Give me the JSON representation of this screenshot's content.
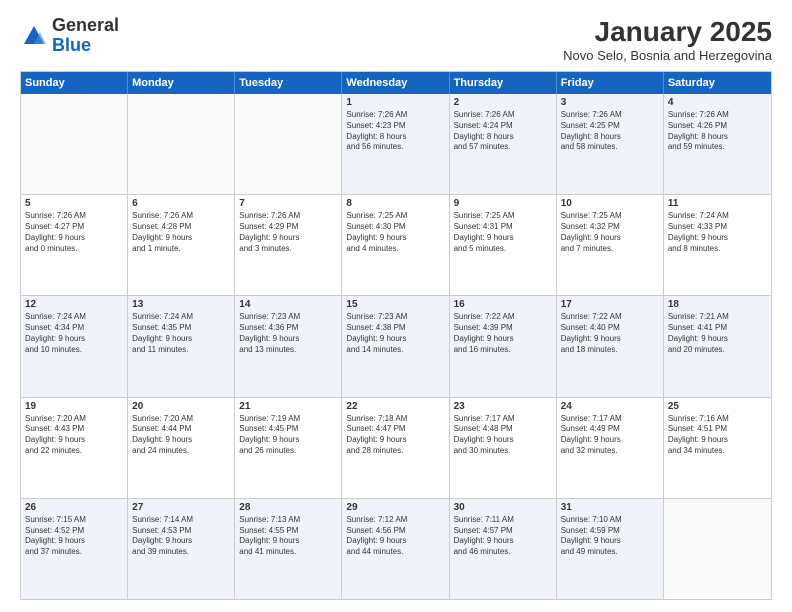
{
  "logo": {
    "general": "General",
    "blue": "Blue"
  },
  "title": {
    "month_year": "January 2025",
    "location": "Novo Selo, Bosnia and Herzegovina"
  },
  "weekdays": [
    "Sunday",
    "Monday",
    "Tuesday",
    "Wednesday",
    "Thursday",
    "Friday",
    "Saturday"
  ],
  "rows": [
    [
      {
        "day": "",
        "lines": []
      },
      {
        "day": "",
        "lines": []
      },
      {
        "day": "",
        "lines": []
      },
      {
        "day": "1",
        "lines": [
          "Sunrise: 7:26 AM",
          "Sunset: 4:23 PM",
          "Daylight: 8 hours",
          "and 56 minutes."
        ]
      },
      {
        "day": "2",
        "lines": [
          "Sunrise: 7:26 AM",
          "Sunset: 4:24 PM",
          "Daylight: 8 hours",
          "and 57 minutes."
        ]
      },
      {
        "day": "3",
        "lines": [
          "Sunrise: 7:26 AM",
          "Sunset: 4:25 PM",
          "Daylight: 8 hours",
          "and 58 minutes."
        ]
      },
      {
        "day": "4",
        "lines": [
          "Sunrise: 7:26 AM",
          "Sunset: 4:26 PM",
          "Daylight: 8 hours",
          "and 59 minutes."
        ]
      }
    ],
    [
      {
        "day": "5",
        "lines": [
          "Sunrise: 7:26 AM",
          "Sunset: 4:27 PM",
          "Daylight: 9 hours",
          "and 0 minutes."
        ]
      },
      {
        "day": "6",
        "lines": [
          "Sunrise: 7:26 AM",
          "Sunset: 4:28 PM",
          "Daylight: 9 hours",
          "and 1 minute."
        ]
      },
      {
        "day": "7",
        "lines": [
          "Sunrise: 7:26 AM",
          "Sunset: 4:29 PM",
          "Daylight: 9 hours",
          "and 3 minutes."
        ]
      },
      {
        "day": "8",
        "lines": [
          "Sunrise: 7:25 AM",
          "Sunset: 4:30 PM",
          "Daylight: 9 hours",
          "and 4 minutes."
        ]
      },
      {
        "day": "9",
        "lines": [
          "Sunrise: 7:25 AM",
          "Sunset: 4:31 PM",
          "Daylight: 9 hours",
          "and 5 minutes."
        ]
      },
      {
        "day": "10",
        "lines": [
          "Sunrise: 7:25 AM",
          "Sunset: 4:32 PM",
          "Daylight: 9 hours",
          "and 7 minutes."
        ]
      },
      {
        "day": "11",
        "lines": [
          "Sunrise: 7:24 AM",
          "Sunset: 4:33 PM",
          "Daylight: 9 hours",
          "and 8 minutes."
        ]
      }
    ],
    [
      {
        "day": "12",
        "lines": [
          "Sunrise: 7:24 AM",
          "Sunset: 4:34 PM",
          "Daylight: 9 hours",
          "and 10 minutes."
        ]
      },
      {
        "day": "13",
        "lines": [
          "Sunrise: 7:24 AM",
          "Sunset: 4:35 PM",
          "Daylight: 9 hours",
          "and 11 minutes."
        ]
      },
      {
        "day": "14",
        "lines": [
          "Sunrise: 7:23 AM",
          "Sunset: 4:36 PM",
          "Daylight: 9 hours",
          "and 13 minutes."
        ]
      },
      {
        "day": "15",
        "lines": [
          "Sunrise: 7:23 AM",
          "Sunset: 4:38 PM",
          "Daylight: 9 hours",
          "and 14 minutes."
        ]
      },
      {
        "day": "16",
        "lines": [
          "Sunrise: 7:22 AM",
          "Sunset: 4:39 PM",
          "Daylight: 9 hours",
          "and 16 minutes."
        ]
      },
      {
        "day": "17",
        "lines": [
          "Sunrise: 7:22 AM",
          "Sunset: 4:40 PM",
          "Daylight: 9 hours",
          "and 18 minutes."
        ]
      },
      {
        "day": "18",
        "lines": [
          "Sunrise: 7:21 AM",
          "Sunset: 4:41 PM",
          "Daylight: 9 hours",
          "and 20 minutes."
        ]
      }
    ],
    [
      {
        "day": "19",
        "lines": [
          "Sunrise: 7:20 AM",
          "Sunset: 4:43 PM",
          "Daylight: 9 hours",
          "and 22 minutes."
        ]
      },
      {
        "day": "20",
        "lines": [
          "Sunrise: 7:20 AM",
          "Sunset: 4:44 PM",
          "Daylight: 9 hours",
          "and 24 minutes."
        ]
      },
      {
        "day": "21",
        "lines": [
          "Sunrise: 7:19 AM",
          "Sunset: 4:45 PM",
          "Daylight: 9 hours",
          "and 26 minutes."
        ]
      },
      {
        "day": "22",
        "lines": [
          "Sunrise: 7:18 AM",
          "Sunset: 4:47 PM",
          "Daylight: 9 hours",
          "and 28 minutes."
        ]
      },
      {
        "day": "23",
        "lines": [
          "Sunrise: 7:17 AM",
          "Sunset: 4:48 PM",
          "Daylight: 9 hours",
          "and 30 minutes."
        ]
      },
      {
        "day": "24",
        "lines": [
          "Sunrise: 7:17 AM",
          "Sunset: 4:49 PM",
          "Daylight: 9 hours",
          "and 32 minutes."
        ]
      },
      {
        "day": "25",
        "lines": [
          "Sunrise: 7:16 AM",
          "Sunset: 4:51 PM",
          "Daylight: 9 hours",
          "and 34 minutes."
        ]
      }
    ],
    [
      {
        "day": "26",
        "lines": [
          "Sunrise: 7:15 AM",
          "Sunset: 4:52 PM",
          "Daylight: 9 hours",
          "and 37 minutes."
        ]
      },
      {
        "day": "27",
        "lines": [
          "Sunrise: 7:14 AM",
          "Sunset: 4:53 PM",
          "Daylight: 9 hours",
          "and 39 minutes."
        ]
      },
      {
        "day": "28",
        "lines": [
          "Sunrise: 7:13 AM",
          "Sunset: 4:55 PM",
          "Daylight: 9 hours",
          "and 41 minutes."
        ]
      },
      {
        "day": "29",
        "lines": [
          "Sunrise: 7:12 AM",
          "Sunset: 4:56 PM",
          "Daylight: 9 hours",
          "and 44 minutes."
        ]
      },
      {
        "day": "30",
        "lines": [
          "Sunrise: 7:11 AM",
          "Sunset: 4:57 PM",
          "Daylight: 9 hours",
          "and 46 minutes."
        ]
      },
      {
        "day": "31",
        "lines": [
          "Sunrise: 7:10 AM",
          "Sunset: 4:59 PM",
          "Daylight: 9 hours",
          "and 49 minutes."
        ]
      },
      {
        "day": "",
        "lines": []
      }
    ]
  ]
}
